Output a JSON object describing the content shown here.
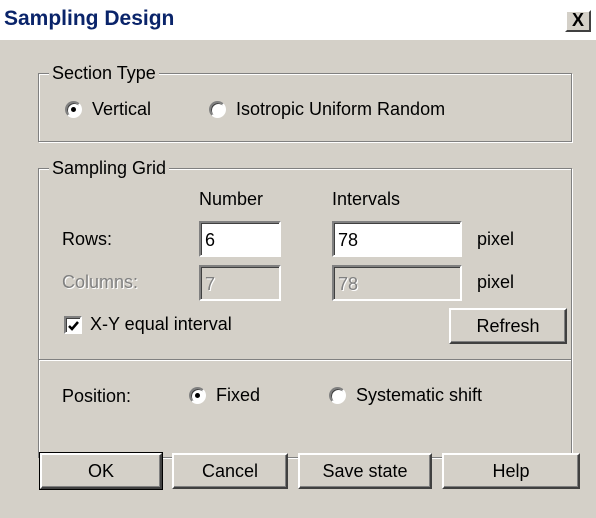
{
  "window": {
    "title": "Sampling Design",
    "close_label": "X"
  },
  "section_type": {
    "legend": "Section Type",
    "options": [
      {
        "label": "Vertical",
        "checked": true
      },
      {
        "label": "Isotropic Uniform Random",
        "checked": false
      }
    ]
  },
  "sampling_grid": {
    "legend": "Sampling Grid",
    "col_number": "Number",
    "col_intervals": "Intervals",
    "rows": {
      "label": "Rows:",
      "number": "6",
      "interval": "78",
      "unit": "pixel"
    },
    "columns": {
      "label": "Columns:",
      "number": "7",
      "interval": "78",
      "unit": "pixel"
    },
    "equal_interval": {
      "label": "X-Y equal interval",
      "checked": true
    },
    "refresh_label": "Refresh",
    "position": {
      "label": "Position:",
      "options": [
        {
          "label": "Fixed",
          "checked": true
        },
        {
          "label": "Systematic shift",
          "checked": false
        }
      ]
    }
  },
  "buttons": {
    "ok": "OK",
    "cancel": "Cancel",
    "save_state": "Save state",
    "help": "Help"
  }
}
